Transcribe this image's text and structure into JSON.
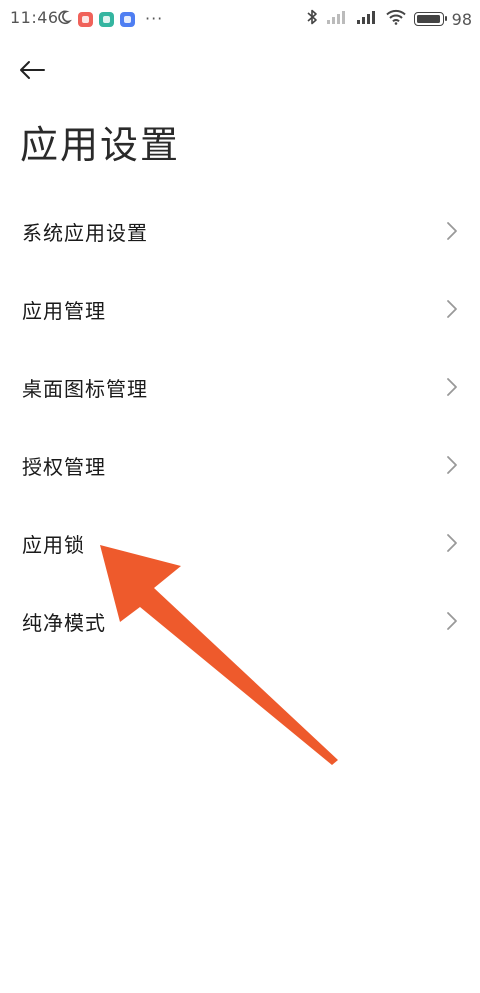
{
  "status_bar": {
    "time": "11:46",
    "battery_text": "98",
    "battery_level": 0.98,
    "app_icons": [
      {
        "name": "red-app-icon",
        "color": "#f0625a"
      },
      {
        "name": "green-app-icon",
        "color": "#34b5a0"
      },
      {
        "name": "blue-app-icon",
        "color": "#4e7ef2"
      }
    ],
    "icons": [
      "moon-icon",
      "bluetooth-icon",
      "signal-icon",
      "signal-icon",
      "wifi-icon",
      "battery-icon"
    ]
  },
  "header": {
    "back_icon": "arrow-left-icon",
    "title": "应用设置"
  },
  "settings": {
    "items": [
      {
        "label": "系统应用设置"
      },
      {
        "label": "应用管理"
      },
      {
        "label": "桌面图标管理"
      },
      {
        "label": "授权管理"
      },
      {
        "label": "应用锁"
      },
      {
        "label": "纯净模式"
      }
    ],
    "chevron_icon": "chevron-right-icon"
  },
  "annotation": {
    "arrow_color": "#ee5a2c",
    "target": "应用锁"
  }
}
